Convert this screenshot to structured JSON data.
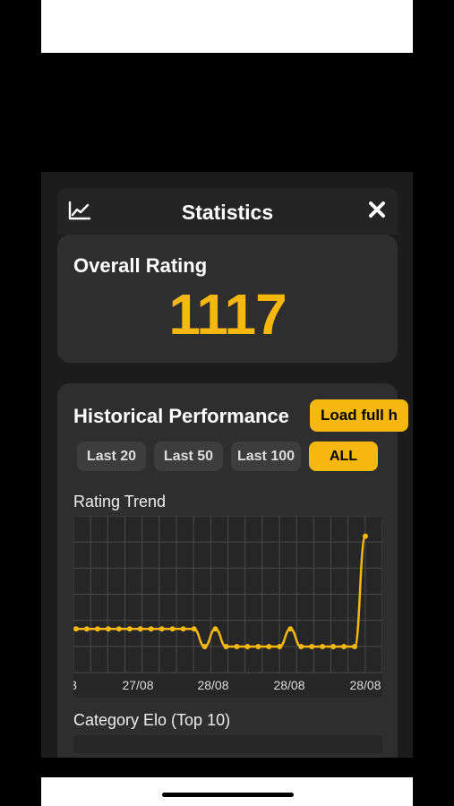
{
  "header": {
    "title": "Statistics",
    "left_icon": "line-chart-icon",
    "close_icon": "close-icon"
  },
  "rating": {
    "label": "Overall Rating",
    "value": "1117"
  },
  "historical": {
    "title": "Historical Performance",
    "load_button_label": "Load full h",
    "filters": [
      {
        "label": "Last 20",
        "active": false
      },
      {
        "label": "Last 50",
        "active": false
      },
      {
        "label": "Last 100",
        "active": false
      },
      {
        "label": "ALL",
        "active": true
      }
    ],
    "trend_label": "Rating Trend",
    "category_label": "Category Elo (Top 10)"
  },
  "colors": {
    "accent": "#f6b70f",
    "background": "#1c1c1c",
    "card": "#2e2e2e"
  },
  "chart_data": {
    "type": "line",
    "title": "Rating Trend",
    "xlabel": "",
    "ylabel": "",
    "x_tick_labels": [
      "3",
      "27/08",
      "28/08",
      "28/08",
      "28/08"
    ],
    "series": [
      {
        "values": [
          1002,
          1002,
          1002,
          1002,
          1002,
          1002,
          1002,
          1002,
          1002,
          1002,
          1002,
          1002,
          980,
          1002,
          980,
          980,
          980,
          980,
          980,
          980,
          1002,
          980,
          980,
          980,
          980,
          980,
          980,
          1117
        ]
      }
    ],
    "ylim": [
      960,
      1130
    ],
    "grid": true,
    "show_markers": true
  }
}
